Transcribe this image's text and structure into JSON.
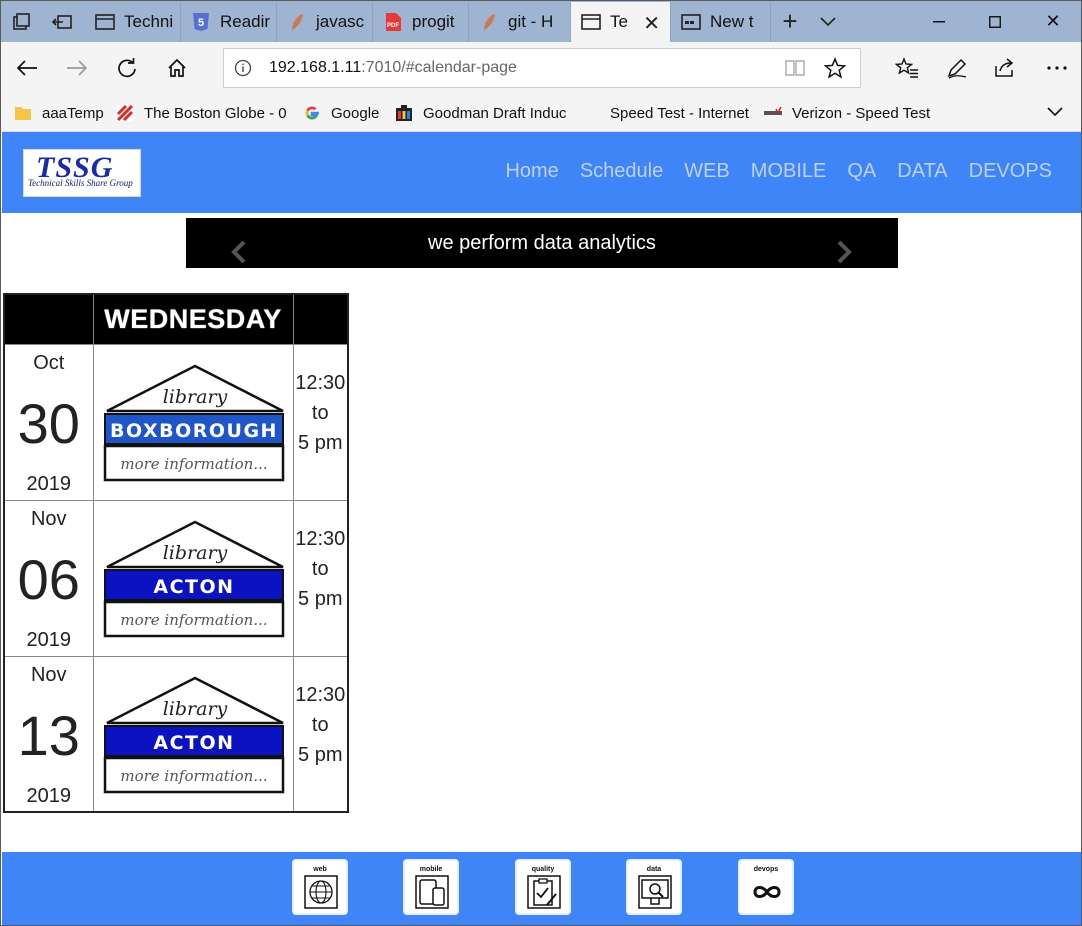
{
  "browser": {
    "tabs": [
      {
        "label": "Techni",
        "icon": "window-icon"
      },
      {
        "label": "Readir",
        "icon": "html5-icon"
      },
      {
        "label": "javasc",
        "icon": "leaf-icon"
      },
      {
        "label": "progit",
        "icon": "pdf-icon"
      },
      {
        "label": "git - H",
        "icon": "leaf-icon"
      },
      {
        "label": "Te",
        "icon": "window-icon",
        "active": true
      },
      {
        "label": "New t",
        "icon": "newtab-icon"
      }
    ],
    "url_host": "192.168.1.11",
    "url_rest": ":7010/#calendar-page",
    "favorites": [
      {
        "label": "aaaTemp",
        "icon": "folder-icon"
      },
      {
        "label": "The Boston Globe - 0",
        "icon": "globe-news-icon"
      },
      {
        "label": "Google",
        "icon": "google-icon"
      },
      {
        "label": "Goodman Draft Induc",
        "icon": "goodman-icon"
      },
      {
        "label": "Speed Test - Internet",
        "icon": "none"
      },
      {
        "label": "Verizon - Speed Test",
        "icon": "verizon-icon"
      }
    ]
  },
  "site": {
    "logo_text": "TSSG",
    "logo_sub": "Technical Skills Share Group",
    "nav": [
      "Home",
      "Schedule",
      "WEB",
      "MOBILE",
      "QA",
      "DATA",
      "DEVOPS"
    ],
    "carousel_caption": "we perform data analytics",
    "calendar": {
      "day_header": "WEDNESDAY",
      "rows": [
        {
          "month": "Oct",
          "day": "30",
          "year": "2019",
          "library_word": "library",
          "library_name": "BOXBOROUGH",
          "more": "more information...",
          "time_start": "12:30",
          "time_to": "to",
          "time_end": "5 pm",
          "banner_color": "#1e55c9"
        },
        {
          "month": "Nov",
          "day": "06",
          "year": "2019",
          "library_word": "library",
          "library_name": "ACTON",
          "more": "more information...",
          "time_start": "12:30",
          "time_to": "to",
          "time_end": "5 pm",
          "banner_color": "#0b12c2"
        },
        {
          "month": "Nov",
          "day": "13",
          "year": "2019",
          "library_word": "library",
          "library_name": "ACTON",
          "more": "more information...",
          "time_start": "12:30",
          "time_to": "to",
          "time_end": "5 pm",
          "banner_color": "#0b12c2"
        }
      ]
    },
    "footer_icons": [
      {
        "label": "web",
        "icon": "web-globe-icon"
      },
      {
        "label": "mobile",
        "icon": "mobile-devices-icon"
      },
      {
        "label": "quality",
        "icon": "quality-clipboard-icon"
      },
      {
        "label": "data",
        "icon": "data-analytics-icon"
      },
      {
        "label": "devops",
        "icon": "devops-infinity-icon"
      }
    ],
    "colors": {
      "header_blue": "#3f85f7",
      "nav_text": "#bcd2ff"
    }
  }
}
